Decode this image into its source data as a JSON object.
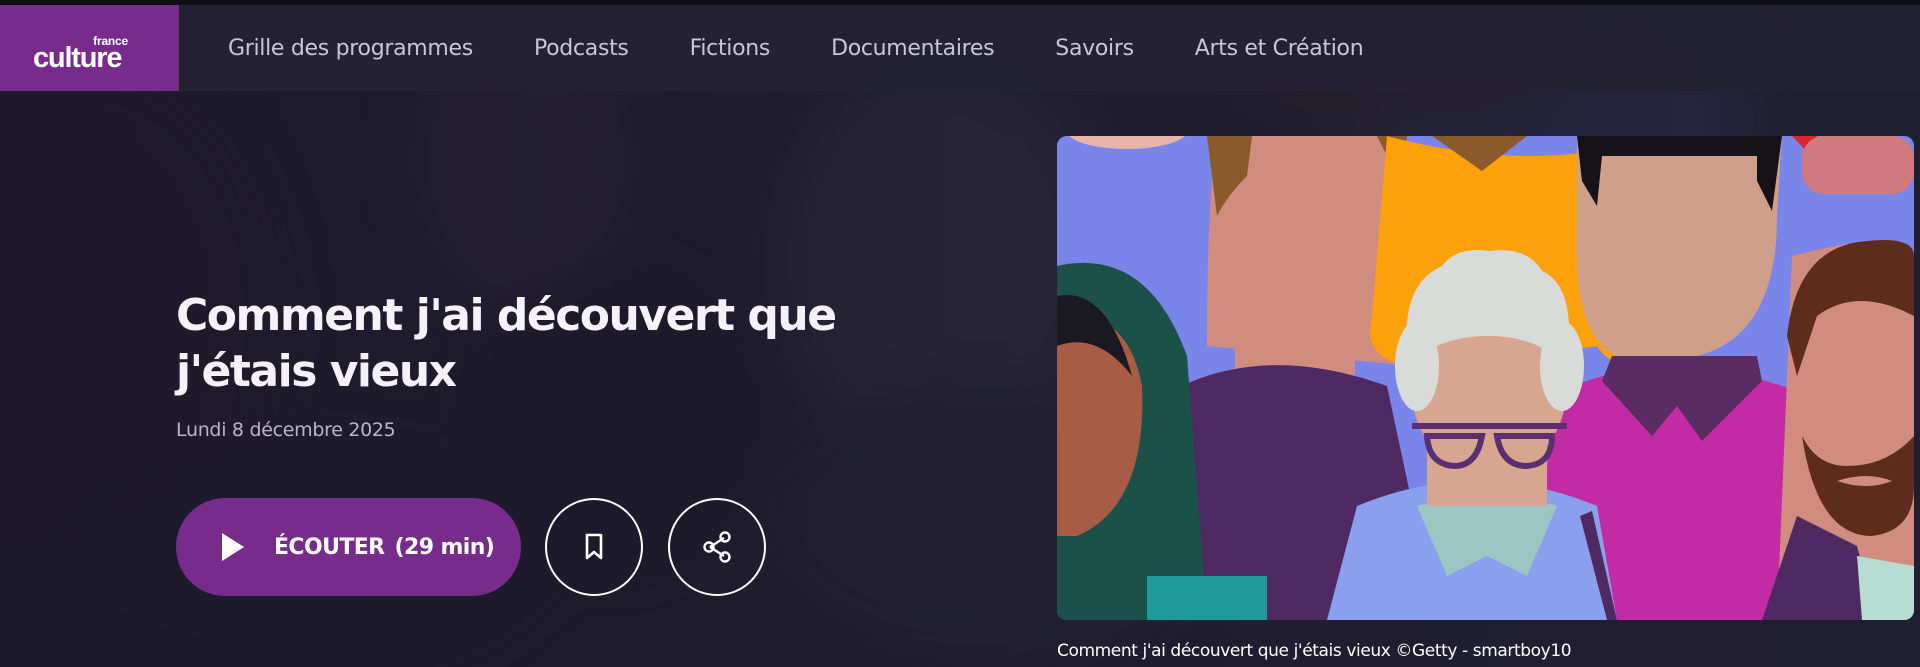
{
  "brand": {
    "line1": "france",
    "line2": "culture",
    "color": "#772c8c"
  },
  "nav": {
    "items": [
      {
        "label": "Grille des programmes"
      },
      {
        "label": "Podcasts"
      },
      {
        "label": "Fictions"
      },
      {
        "label": "Documentaires"
      },
      {
        "label": "Savoirs"
      },
      {
        "label": "Arts et Création"
      }
    ]
  },
  "episode": {
    "title_line1": "Comment j'ai découvert que",
    "title_line2": "j'étais vieux",
    "date": "Lundi 8 décembre 2025"
  },
  "actions": {
    "listen_label": "ÉCOUTER",
    "listen_duration": "(29 min)",
    "play_icon": "play-icon",
    "bookmark_icon": "bookmark-icon",
    "share_icon": "share-icon"
  },
  "image": {
    "caption": "Comment j'ai découvert que j'étais vieux ©Getty - smartboy10"
  }
}
